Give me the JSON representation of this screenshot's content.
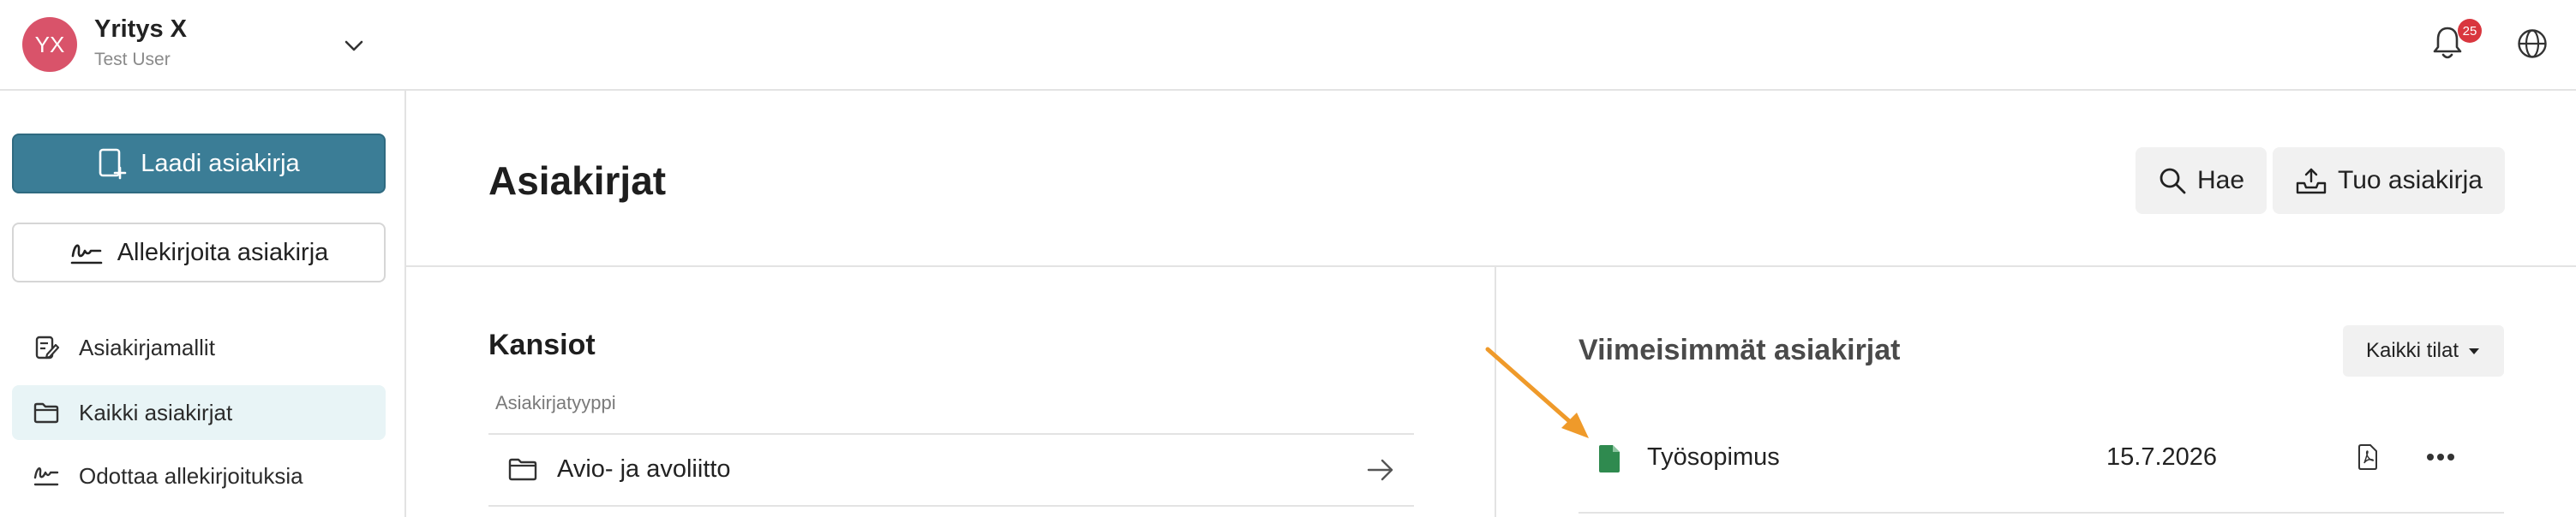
{
  "header": {
    "avatar_initials": "YX",
    "company_name": "Yritys X",
    "user_name": "Test User",
    "notification_count": "25"
  },
  "sidebar": {
    "create_label": "Laadi asiakirja",
    "sign_label": "Allekirjoita asiakirja",
    "items": [
      {
        "label": "Asiakirjamallit",
        "icon": "template-icon"
      },
      {
        "label": "Kaikki asiakirjat",
        "icon": "folder-icon",
        "active": true
      },
      {
        "label": "Odottaa allekirjoituksia",
        "icon": "signature-icon"
      }
    ]
  },
  "main": {
    "title": "Asiakirjat",
    "search_label": "Hae",
    "import_label": "Tuo asiakirja",
    "folders": {
      "title": "Kansiot",
      "subtitle": "Asiakirjatyyppi",
      "items": [
        {
          "label": "Avio- ja avoliitto"
        }
      ]
    },
    "recent": {
      "title": "Viimeisimmät asiakirjat",
      "filter_label": "Kaikki tilat",
      "documents": [
        {
          "name": "Työsopimus",
          "date": "15.7.2026"
        }
      ]
    }
  },
  "colors": {
    "accent": "#3b7d96",
    "avatar": "#d9536a",
    "badge": "#d9363e",
    "document_icon": "#2f8a4f",
    "annotation_arrow": "#ef9a2a",
    "active_nav": "#e8f4f6"
  }
}
